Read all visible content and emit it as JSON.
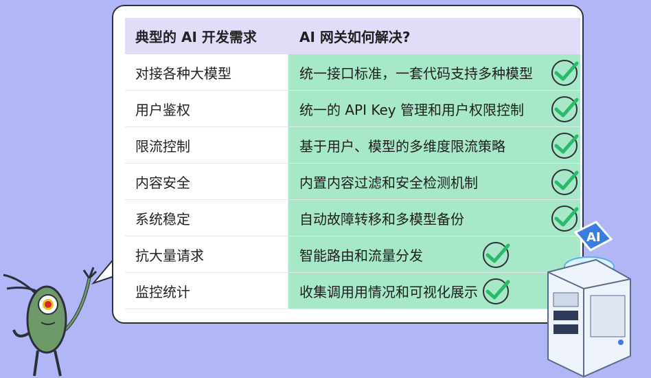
{
  "table": {
    "header": {
      "left": "典型的 AI 开发需求",
      "right": "AI 网关如何解决?"
    },
    "rows": [
      {
        "need": "对接各种大模型",
        "solution": "统一接口标准，一套代码支持多种模型"
      },
      {
        "need": "用户鉴权",
        "solution": "统一的 API Key 管理和用户权限控制"
      },
      {
        "need": "限流控制",
        "solution": "基于用户、模型的多维度限流策略"
      },
      {
        "need": "内容安全",
        "solution": "内置内容过滤和安全检测机制"
      },
      {
        "need": "系统稳定",
        "solution": "自动故障转移和多模型备份"
      },
      {
        "need": "抗大量请求",
        "solution": "智能路由和流量分发"
      },
      {
        "need": "监控统计",
        "solution": "收集调用用情况和可视化展示"
      }
    ]
  },
  "server_badge": "AI",
  "icons": [
    "check-icon",
    "plankton-character",
    "ai-server-illustration"
  ],
  "colors": {
    "background": "#b0b6f6",
    "header_bg": "#e2dcf8",
    "solution_bg": "#a7e8c8",
    "check": "#2aba6b"
  }
}
